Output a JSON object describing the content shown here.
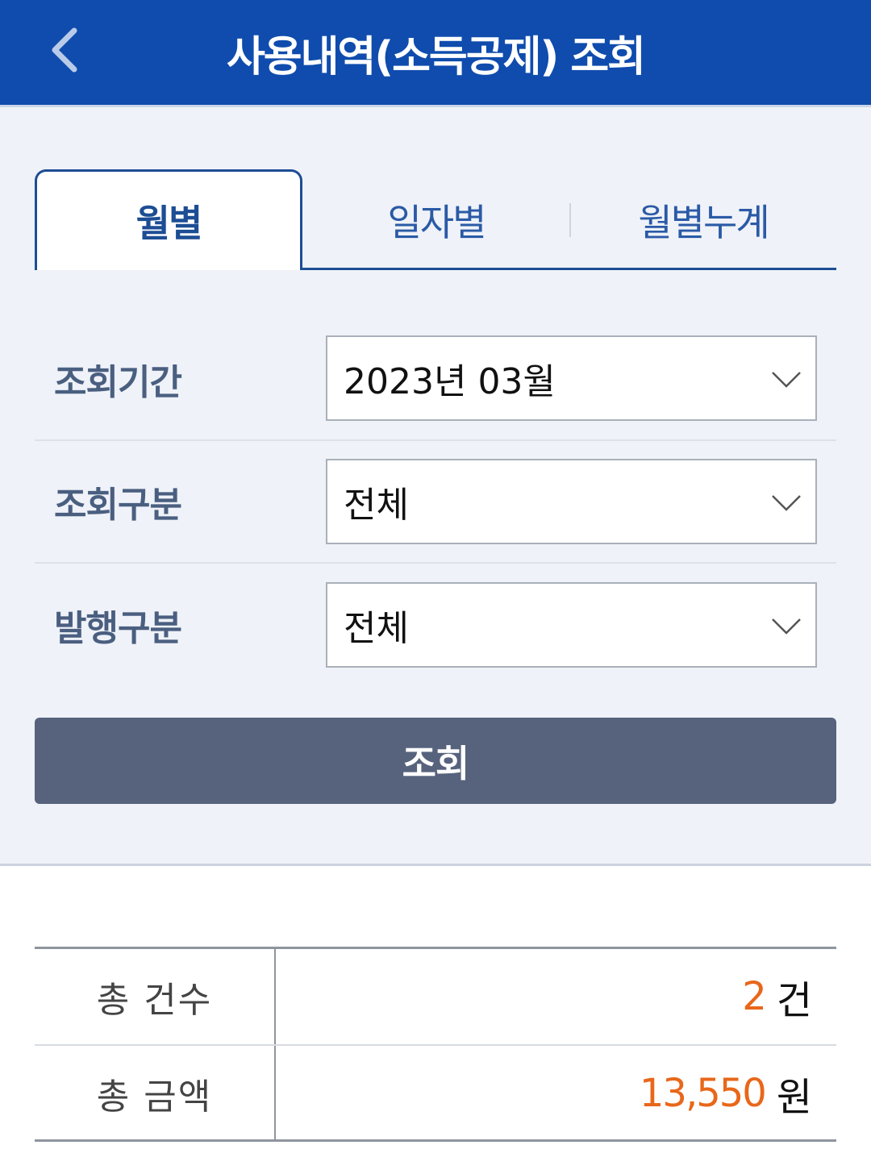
{
  "header": {
    "title": "사용내역(소득공제) 조회",
    "back_icon": "chevron-left-icon"
  },
  "tabs": [
    {
      "label": "월별",
      "active": true
    },
    {
      "label": "일자별",
      "active": false
    },
    {
      "label": "월별누계",
      "active": false
    }
  ],
  "form": {
    "period": {
      "label": "조회기간",
      "value": "2023년 03월"
    },
    "type": {
      "label": "조회구분",
      "value": "전체"
    },
    "issue": {
      "label": "발행구분",
      "value": "전체"
    }
  },
  "query_button": {
    "label": "조회"
  },
  "summary": {
    "count": {
      "label": "총 건수",
      "value": "2",
      "unit": "건"
    },
    "amount": {
      "label": "총 금액",
      "value": "13,550",
      "unit": "원"
    }
  },
  "colors": {
    "header_bg": "#0f4cad",
    "tab_accent": "#1d4d94",
    "button_bg": "#57637d",
    "highlight_number": "#e8671a",
    "panel_bg": "#eff2f8"
  }
}
